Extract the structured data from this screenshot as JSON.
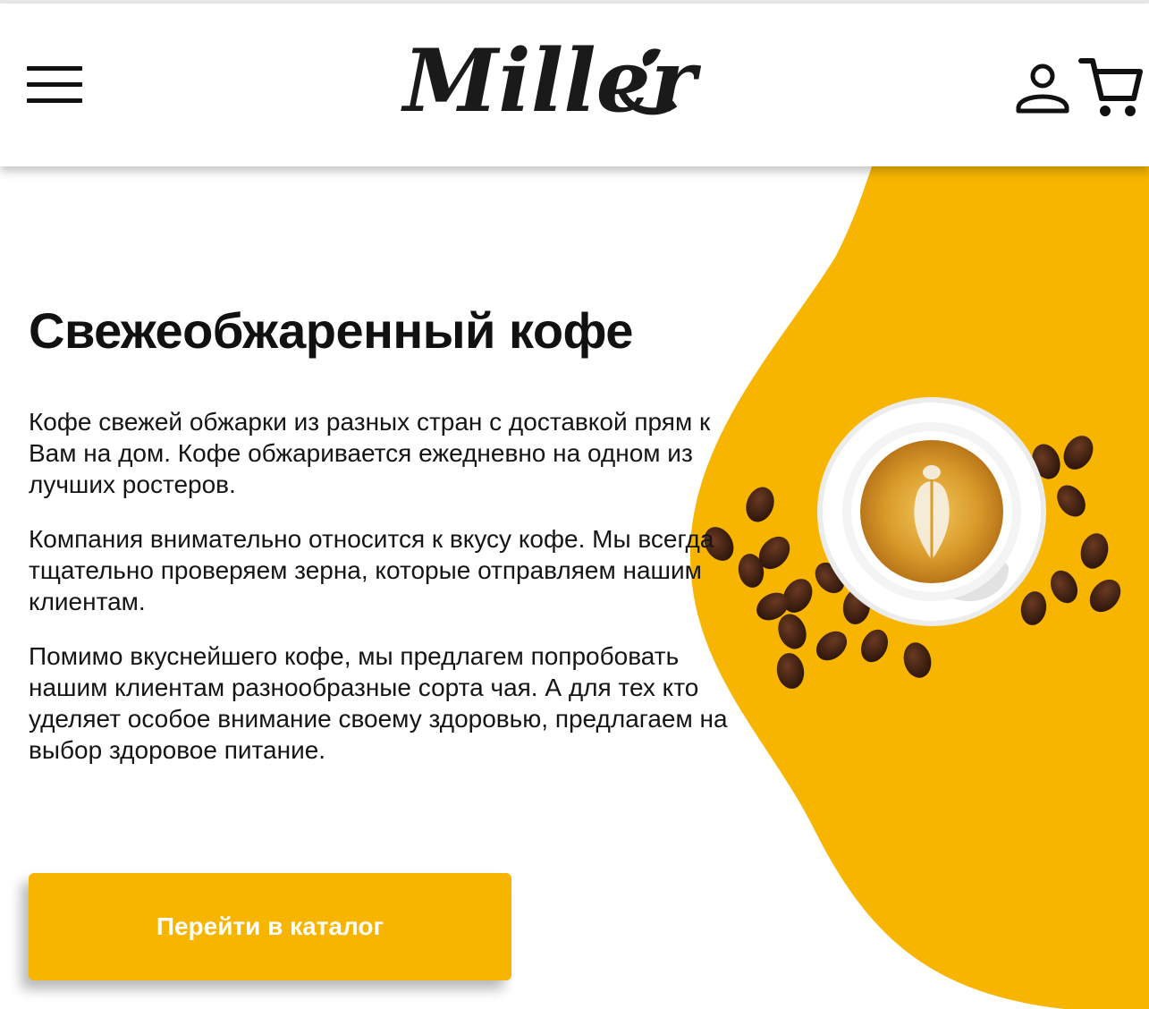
{
  "header": {
    "logo_text": "Miller",
    "icons": [
      "menu-icon",
      "user-icon",
      "cart-icon"
    ]
  },
  "hero": {
    "title": "Свежеобжаренный кофе",
    "paragraphs": [
      "Кофе свежей обжарки из разных стран с доставкой прям к Вам на дом. Кофе обжаривается ежедневно на одном из лучших ростеров.",
      "Компания внимательно относится к вкусу кофе. Мы всегда тщательно проверяем зерна, которые отправляем нашим клиентам.",
      "Помимо вкуснейшего кофе, мы предлагем попробовать нашим клиентам разнообразные сорта чая. А для тех кто уделяет особое внимание своему здоровью, предлагаем на выбор здоровое питание."
    ],
    "cta_label": "Перейти в каталог"
  },
  "colors": {
    "accent": "#f7b500",
    "text": "#111111",
    "background": "#ffffff"
  }
}
